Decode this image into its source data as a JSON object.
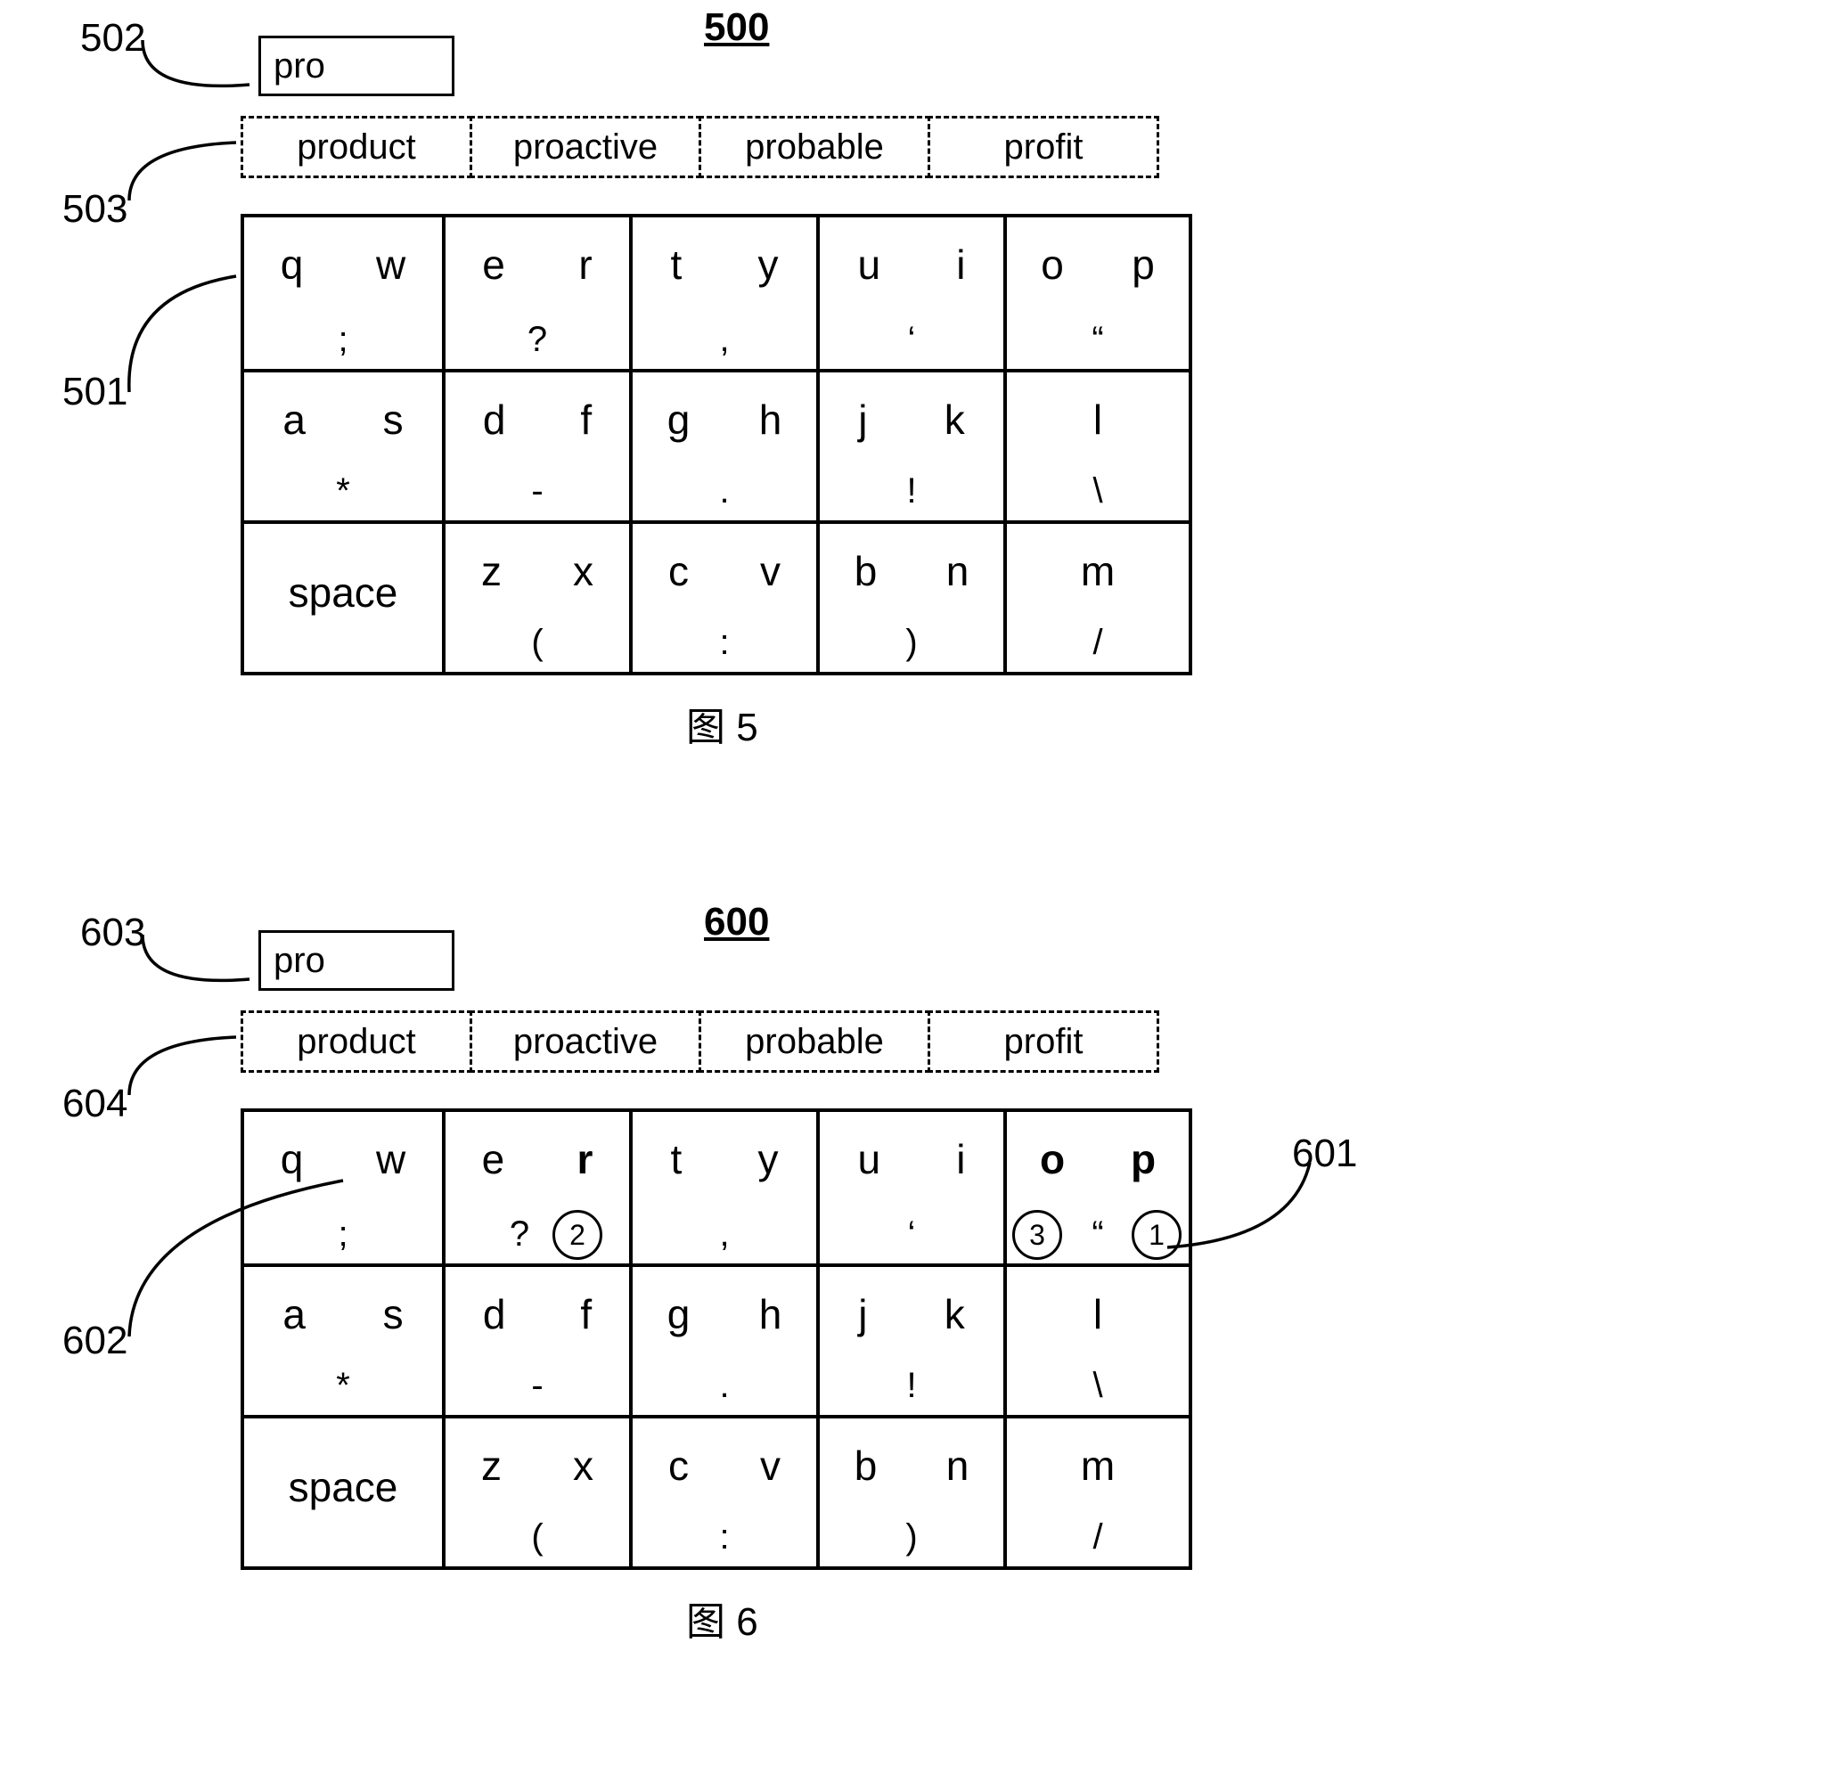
{
  "fig5": {
    "number": "500",
    "caption": "图 5",
    "callouts": {
      "input": "502",
      "suggestions": "503",
      "keyboard": "501"
    },
    "input_value": "pro",
    "suggestions": [
      "product",
      "proactive",
      "probable",
      "profit"
    ],
    "keys": {
      "qw": {
        "letters": [
          "q",
          "w"
        ],
        "sym": ";",
        "bold": []
      },
      "er": {
        "letters": [
          "e",
          "r"
        ],
        "sym": "?",
        "bold": []
      },
      "ty": {
        "letters": [
          "t",
          "y"
        ],
        "sym": ",",
        "bold": []
      },
      "ui": {
        "letters": [
          "u",
          "i"
        ],
        "sym": "‘",
        "bold": []
      },
      "op": {
        "letters": [
          "o",
          "p"
        ],
        "sym": "“",
        "bold": []
      },
      "as": {
        "letters": [
          "a",
          "s"
        ],
        "sym": "*",
        "bold": []
      },
      "df": {
        "letters": [
          "d",
          "f"
        ],
        "sym": "-",
        "bold": []
      },
      "gh": {
        "letters": [
          "g",
          "h"
        ],
        "sym": ".",
        "bold": []
      },
      "jk": {
        "letters": [
          "j",
          "k"
        ],
        "sym": "!",
        "bold": []
      },
      "l": {
        "letters": [
          "l"
        ],
        "sym": "\\",
        "bold": []
      },
      "space": {
        "letters": [
          "space"
        ],
        "sym": "",
        "bold": []
      },
      "zx": {
        "letters": [
          "z",
          "x"
        ],
        "sym": "(",
        "bold": []
      },
      "cv": {
        "letters": [
          "c",
          "v"
        ],
        "sym": ":",
        "bold": []
      },
      "bn": {
        "letters": [
          "b",
          "n"
        ],
        "sym": ")",
        "bold": []
      },
      "m": {
        "letters": [
          "m"
        ],
        "sym": "/",
        "bold": []
      }
    }
  },
  "fig6": {
    "number": "600",
    "caption": "图 6",
    "callouts": {
      "input": "603",
      "suggestions": "604",
      "keyboard": "602",
      "op_key": "601"
    },
    "input_value": "pro",
    "suggestions": [
      "product",
      "proactive",
      "probable",
      "profit"
    ],
    "keys": {
      "qw": {
        "letters": [
          "q",
          "w"
        ],
        "sym": ";",
        "bold": []
      },
      "er": {
        "letters": [
          "e",
          "r"
        ],
        "sym": "?",
        "bold": [
          "r"
        ],
        "circle_after_sym": "2"
      },
      "ty": {
        "letters": [
          "t",
          "y"
        ],
        "sym": ",",
        "bold": []
      },
      "ui": {
        "letters": [
          "u",
          "i"
        ],
        "sym": "‘",
        "bold": []
      },
      "op": {
        "letters": [
          "o",
          "p"
        ],
        "sym": "“",
        "bold": [
          "o",
          "p"
        ],
        "circle_before_sym": "3",
        "circle_after_sym": "1"
      },
      "as": {
        "letters": [
          "a",
          "s"
        ],
        "sym": "*",
        "bold": []
      },
      "df": {
        "letters": [
          "d",
          "f"
        ],
        "sym": "-",
        "bold": []
      },
      "gh": {
        "letters": [
          "g",
          "h"
        ],
        "sym": ".",
        "bold": []
      },
      "jk": {
        "letters": [
          "j",
          "k"
        ],
        "sym": "!",
        "bold": []
      },
      "l": {
        "letters": [
          "l"
        ],
        "sym": "\\",
        "bold": []
      },
      "space": {
        "letters": [
          "space"
        ],
        "sym": "",
        "bold": []
      },
      "zx": {
        "letters": [
          "z",
          "x"
        ],
        "sym": "(",
        "bold": []
      },
      "cv": {
        "letters": [
          "c",
          "v"
        ],
        "sym": ":",
        "bold": []
      },
      "bn": {
        "letters": [
          "b",
          "n"
        ],
        "sym": ")",
        "bold": []
      },
      "m": {
        "letters": [
          "m"
        ],
        "sym": "/",
        "bold": []
      }
    }
  }
}
